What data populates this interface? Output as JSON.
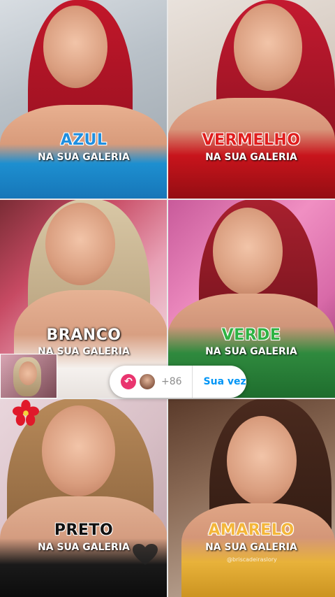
{
  "tiles": [
    {
      "color_word": "AZUL",
      "caption": "NA SUA GALERIA",
      "color": "#1f8fe0"
    },
    {
      "color_word": "VERMELHO",
      "caption": "NA SUA GALERIA",
      "color": "#e01e1e"
    },
    {
      "color_word": "BRANCO",
      "caption": "NA SUA GALERIA",
      "color": "#ffffff"
    },
    {
      "color_word": "VERDE",
      "caption": "NA SUA GALERIA",
      "color": "#2fb344"
    },
    {
      "color_word": "PRETO",
      "caption": "NA SUA GALERIA",
      "color": "#111111"
    },
    {
      "color_word": "AMARELO",
      "caption": "NA SUA GALERIA",
      "color": "#f4b63a"
    }
  ],
  "reply_bar": {
    "count": "+86",
    "action": "Sua vez"
  },
  "watermark": "@briscadeiraslory"
}
